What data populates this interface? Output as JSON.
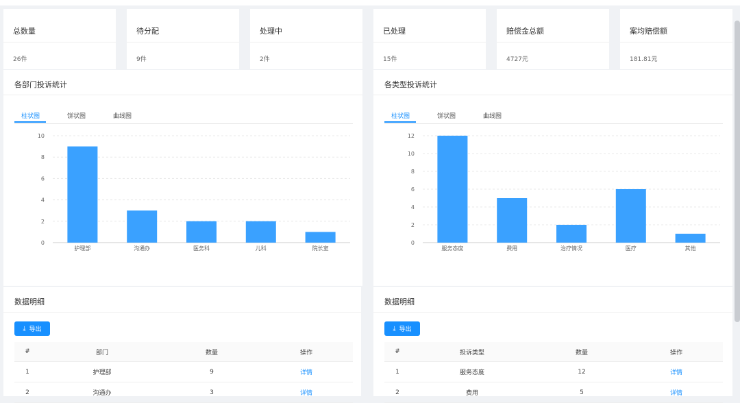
{
  "stats": [
    {
      "title": "总数量",
      "value": "26件"
    },
    {
      "title": "待分配",
      "value": "9件"
    },
    {
      "title": "处理中",
      "value": "2件"
    },
    {
      "title": "已处理",
      "value": "15件"
    },
    {
      "title": "赔偿金总额",
      "value": "4727元"
    },
    {
      "title": "案均赔偿额",
      "value": "181.81元"
    }
  ],
  "tabs": [
    "柱状图",
    "饼状图",
    "曲线图"
  ],
  "dept_chart": {
    "title": "各部门投诉统计",
    "active_tab": 0
  },
  "type_chart": {
    "title": "各类型投诉统计",
    "active_tab": 0
  },
  "chart_data": [
    {
      "type": "bar",
      "categories": [
        "护理部",
        "沟通办",
        "医务科",
        "儿科",
        "院长室"
      ],
      "values": [
        9,
        3,
        2,
        2,
        1
      ],
      "ylim": [
        0,
        10
      ],
      "yticks": [
        "0",
        "2",
        "4",
        "6",
        "8",
        "10"
      ],
      "color": "#3aa1ff"
    },
    {
      "type": "bar",
      "categories": [
        "服务态度",
        "费用",
        "治疗情况",
        "医疗",
        "其他"
      ],
      "values": [
        12,
        5,
        2,
        6,
        1
      ],
      "ylim": [
        0,
        12
      ],
      "yticks": [
        "0",
        "2",
        "4",
        "6",
        "8",
        "10",
        "12"
      ],
      "color": "#3aa1ff"
    }
  ],
  "detail_left": {
    "title": "数据明细",
    "export_label": "导出",
    "columns": [
      "#",
      "部门",
      "数量",
      "操作"
    ],
    "rows": [
      {
        "idx": "1",
        "name": "护理部",
        "count": "9",
        "action": "详情"
      },
      {
        "idx": "2",
        "name": "沟通办",
        "count": "3",
        "action": "详情"
      }
    ]
  },
  "detail_right": {
    "title": "数据明细",
    "export_label": "导出",
    "columns": [
      "#",
      "投诉类型",
      "数量",
      "操作"
    ],
    "rows": [
      {
        "idx": "1",
        "name": "服务态度",
        "count": "12",
        "action": "详情"
      },
      {
        "idx": "2",
        "name": "费用",
        "count": "5",
        "action": "详情"
      }
    ]
  }
}
